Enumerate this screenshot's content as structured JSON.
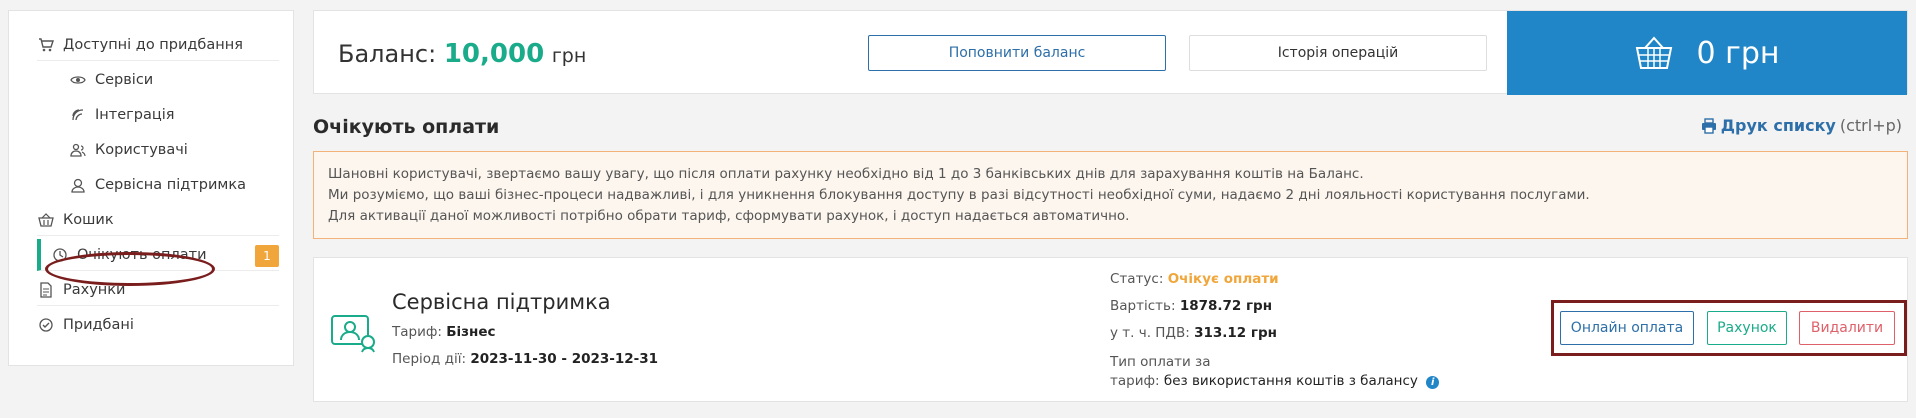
{
  "sidebar": {
    "items": [
      {
        "label": "Доступні до придбання",
        "icon": "cart-icon"
      },
      {
        "label": "Сервіси",
        "icon": "eye-icon"
      },
      {
        "label": "Інтеграція",
        "icon": "integration-icon"
      },
      {
        "label": "Користувачі",
        "icon": "users-icon"
      },
      {
        "label": "Сервісна підтримка",
        "icon": "support-icon"
      },
      {
        "label": "Кошик",
        "icon": "basket-icon"
      },
      {
        "label": "Очікують оплати",
        "icon": "clock-icon",
        "badge": "1"
      },
      {
        "label": "Рахунки",
        "icon": "document-icon"
      },
      {
        "label": "Придбані",
        "icon": "check-circle-icon"
      }
    ]
  },
  "balance": {
    "label": "Баланс:",
    "amount": "10,000",
    "currency": "грн",
    "topup_button": "Поповнити баланс",
    "history_button": "Історія операцій",
    "cart_total": "0 грн"
  },
  "section": {
    "title": "Очікують оплати",
    "print_link": "Друк списку",
    "print_hint": "(ctrl+p)"
  },
  "notice": {
    "lines": [
      "Шановні користувачі, звертаємо вашу увагу, що після оплати рахунку необхідно від 1 до 3 банківських днів для зарахування коштів на Баланс.",
      "Ми розуміємо, що ваші бізнес-процеси надважливі, і для уникнення блокування доступу в разі відсутності необхідної суми, надаємо 2 дні лояльності користування послугами.",
      "Для активації даної можливості потрібно обрати тариф, сформувати рахунок, і доступ надається автоматично."
    ]
  },
  "item": {
    "name": "Сервісна підтримка",
    "tariff_label": "Тариф:",
    "tariff_value": "Бізнес",
    "period_label": "Період дії:",
    "period_value": "2023-11-30 - 2023-12-31",
    "status_label": "Статус:",
    "status_value": "Очікує оплати",
    "cost_label": "Вартість:",
    "cost_value": "1878.72 грн",
    "vat_label": "у т. ч. ПДВ:",
    "vat_value": "313.12 грн",
    "paytype_label_1": "Тип оплати за",
    "paytype_label_2": "тариф:",
    "paytype_value": "без використання коштів з балансу",
    "info_glyph": "i",
    "buttons": {
      "pay": "Онлайн оплата",
      "invoice": "Рахунок",
      "delete": "Видалити"
    }
  },
  "colors": {
    "accent_green": "#1aab8a",
    "primary_blue": "#2086c8",
    "pending_orange": "#f0a63a",
    "delete_red": "#e0606a",
    "highlight_maroon": "#7a1d1d"
  }
}
